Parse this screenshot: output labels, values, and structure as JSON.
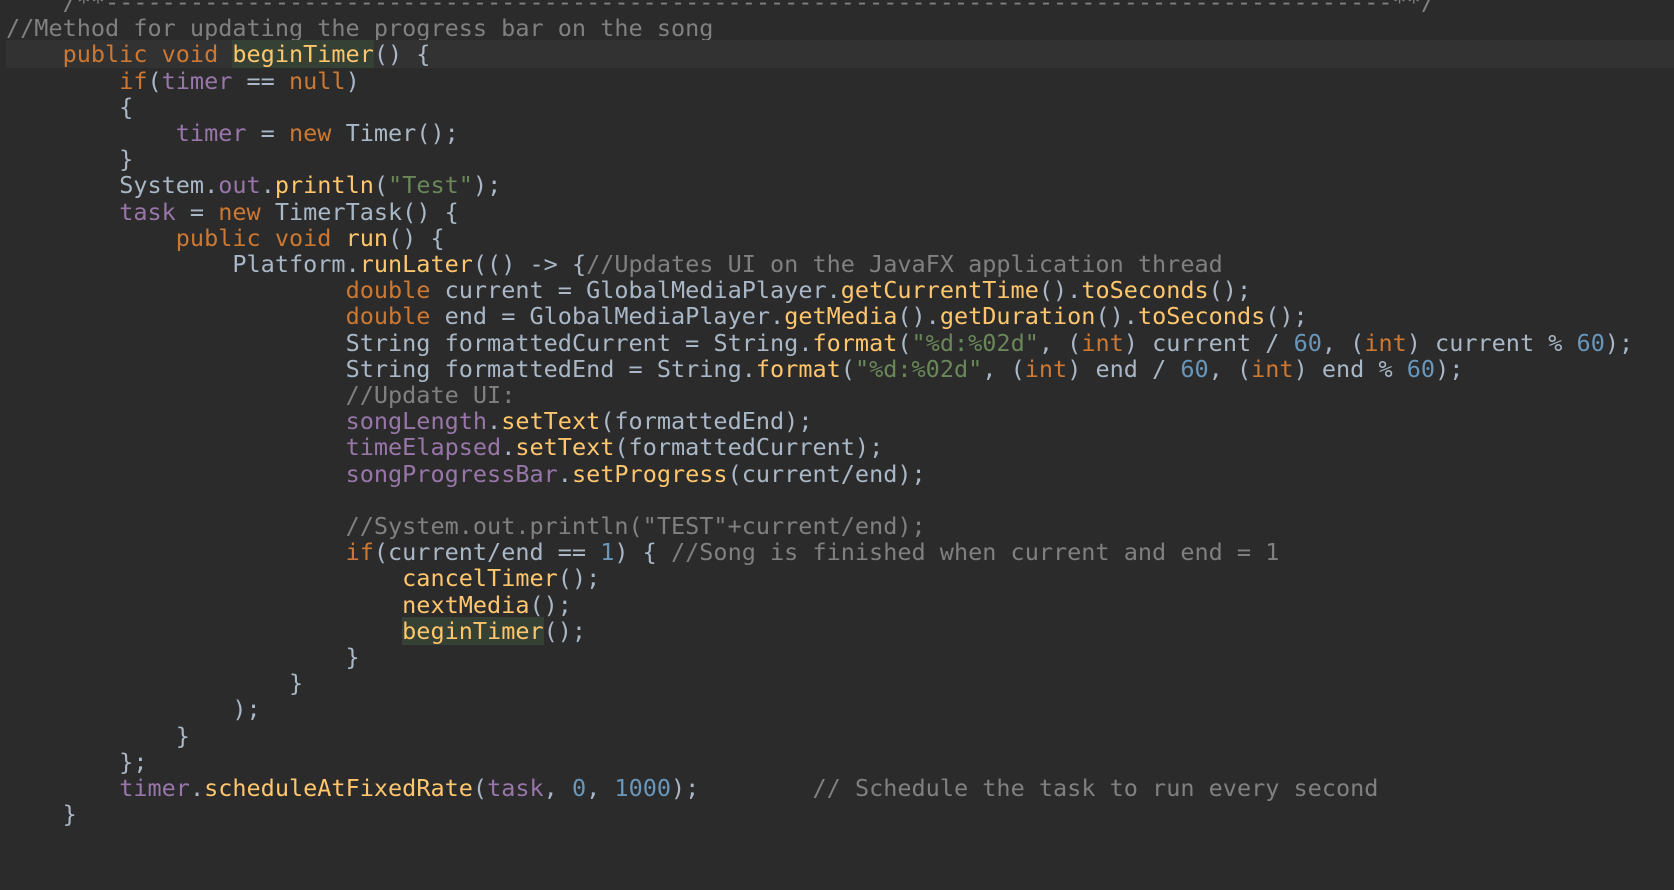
{
  "editor": {
    "lines": [
      [
        {
          "t": "    /**-------------------------------------------------------------------------------------------**/",
          "c": "comment"
        }
      ],
      [
        {
          "t": "//Method for updating the progress bar on the song",
          "c": "comment"
        }
      ],
      [
        {
          "t": "    ",
          "c": "default"
        },
        {
          "t": "public void ",
          "c": "keyword"
        },
        {
          "t": "beginTimer",
          "c": "method",
          "h": true
        },
        {
          "t": "() {",
          "c": "default"
        }
      ],
      [
        {
          "t": "        ",
          "c": "default"
        },
        {
          "t": "if",
          "c": "keyword"
        },
        {
          "t": "(",
          "c": "default"
        },
        {
          "t": "timer",
          "c": "field"
        },
        {
          "t": " == ",
          "c": "default"
        },
        {
          "t": "null",
          "c": "keyword"
        },
        {
          "t": ")",
          "c": "default"
        }
      ],
      [
        {
          "t": "        {",
          "c": "default"
        }
      ],
      [
        {
          "t": "            ",
          "c": "default"
        },
        {
          "t": "timer",
          "c": "field"
        },
        {
          "t": " = ",
          "c": "default"
        },
        {
          "t": "new ",
          "c": "keyword"
        },
        {
          "t": "Timer",
          "c": "class"
        },
        {
          "t": "();",
          "c": "default"
        }
      ],
      [
        {
          "t": "        }",
          "c": "default"
        }
      ],
      [
        {
          "t": "        ",
          "c": "default"
        },
        {
          "t": "System",
          "c": "class"
        },
        {
          "t": ".",
          "c": "default"
        },
        {
          "t": "out",
          "c": "field"
        },
        {
          "t": ".",
          "c": "default"
        },
        {
          "t": "println",
          "c": "method"
        },
        {
          "t": "(",
          "c": "default"
        },
        {
          "t": "\"Test\"",
          "c": "string"
        },
        {
          "t": ");",
          "c": "default"
        }
      ],
      [
        {
          "t": "        ",
          "c": "default"
        },
        {
          "t": "task",
          "c": "field"
        },
        {
          "t": " = ",
          "c": "default"
        },
        {
          "t": "new ",
          "c": "keyword"
        },
        {
          "t": "TimerTask",
          "c": "class"
        },
        {
          "t": "() {",
          "c": "default"
        }
      ],
      [
        {
          "t": "            ",
          "c": "default"
        },
        {
          "t": "public void ",
          "c": "keyword"
        },
        {
          "t": "run",
          "c": "method"
        },
        {
          "t": "() {",
          "c": "default"
        }
      ],
      [
        {
          "t": "                ",
          "c": "default"
        },
        {
          "t": "Platform",
          "c": "class"
        },
        {
          "t": ".",
          "c": "default"
        },
        {
          "t": "runLater",
          "c": "method"
        },
        {
          "t": "(() -> {",
          "c": "default"
        },
        {
          "t": "//Updates UI on the JavaFX application thread",
          "c": "comment"
        }
      ],
      [
        {
          "t": "                        ",
          "c": "default"
        },
        {
          "t": "double ",
          "c": "keyword"
        },
        {
          "t": "current = ",
          "c": "default"
        },
        {
          "t": "GlobalMediaPlayer",
          "c": "class"
        },
        {
          "t": ".",
          "c": "default"
        },
        {
          "t": "getCurrentTime",
          "c": "method"
        },
        {
          "t": "().",
          "c": "default"
        },
        {
          "t": "toSeconds",
          "c": "method"
        },
        {
          "t": "();",
          "c": "default"
        }
      ],
      [
        {
          "t": "                        ",
          "c": "default"
        },
        {
          "t": "double ",
          "c": "keyword"
        },
        {
          "t": "end = ",
          "c": "default"
        },
        {
          "t": "GlobalMediaPlayer",
          "c": "class"
        },
        {
          "t": ".",
          "c": "default"
        },
        {
          "t": "getMedia",
          "c": "method"
        },
        {
          "t": "().",
          "c": "default"
        },
        {
          "t": "getDuration",
          "c": "method"
        },
        {
          "t": "().",
          "c": "default"
        },
        {
          "t": "toSeconds",
          "c": "method"
        },
        {
          "t": "();",
          "c": "default"
        }
      ],
      [
        {
          "t": "                        ",
          "c": "default"
        },
        {
          "t": "String ",
          "c": "class"
        },
        {
          "t": "formattedCurrent = ",
          "c": "default"
        },
        {
          "t": "String",
          "c": "class"
        },
        {
          "t": ".",
          "c": "default"
        },
        {
          "t": "format",
          "c": "method"
        },
        {
          "t": "(",
          "c": "default"
        },
        {
          "t": "\"%d:%02d\"",
          "c": "string"
        },
        {
          "t": ", (",
          "c": "default"
        },
        {
          "t": "int",
          "c": "keyword"
        },
        {
          "t": ") current / ",
          "c": "default"
        },
        {
          "t": "60",
          "c": "number"
        },
        {
          "t": ", (",
          "c": "default"
        },
        {
          "t": "int",
          "c": "keyword"
        },
        {
          "t": ") current % ",
          "c": "default"
        },
        {
          "t": "60",
          "c": "number"
        },
        {
          "t": ");",
          "c": "default"
        }
      ],
      [
        {
          "t": "                        ",
          "c": "default"
        },
        {
          "t": "String ",
          "c": "class"
        },
        {
          "t": "formattedEnd = ",
          "c": "default"
        },
        {
          "t": "String",
          "c": "class"
        },
        {
          "t": ".",
          "c": "default"
        },
        {
          "t": "format",
          "c": "method"
        },
        {
          "t": "(",
          "c": "default"
        },
        {
          "t": "\"%d:%02d\"",
          "c": "string"
        },
        {
          "t": ", (",
          "c": "default"
        },
        {
          "t": "int",
          "c": "keyword"
        },
        {
          "t": ") end / ",
          "c": "default"
        },
        {
          "t": "60",
          "c": "number"
        },
        {
          "t": ", (",
          "c": "default"
        },
        {
          "t": "int",
          "c": "keyword"
        },
        {
          "t": ") end % ",
          "c": "default"
        },
        {
          "t": "60",
          "c": "number"
        },
        {
          "t": ");",
          "c": "default"
        }
      ],
      [
        {
          "t": "                        ",
          "c": "default"
        },
        {
          "t": "//Update UI:",
          "c": "comment"
        }
      ],
      [
        {
          "t": "                        ",
          "c": "default"
        },
        {
          "t": "songLength",
          "c": "field"
        },
        {
          "t": ".",
          "c": "default"
        },
        {
          "t": "setText",
          "c": "method"
        },
        {
          "t": "(formattedEnd);",
          "c": "default"
        }
      ],
      [
        {
          "t": "                        ",
          "c": "default"
        },
        {
          "t": "timeElapsed",
          "c": "field"
        },
        {
          "t": ".",
          "c": "default"
        },
        {
          "t": "setText",
          "c": "method"
        },
        {
          "t": "(formattedCurrent);",
          "c": "default"
        }
      ],
      [
        {
          "t": "                        ",
          "c": "default"
        },
        {
          "t": "songProgressBar",
          "c": "field"
        },
        {
          "t": ".",
          "c": "default"
        },
        {
          "t": "setProgress",
          "c": "method"
        },
        {
          "t": "(current/end);",
          "c": "default"
        }
      ],
      [
        {
          "t": "",
          "c": "default"
        }
      ],
      [
        {
          "t": "                        ",
          "c": "default"
        },
        {
          "t": "//System.out.println(\"TEST\"+current/end);",
          "c": "comment"
        }
      ],
      [
        {
          "t": "                        ",
          "c": "default"
        },
        {
          "t": "if",
          "c": "keyword"
        },
        {
          "t": "(current/end == ",
          "c": "default"
        },
        {
          "t": "1",
          "c": "number"
        },
        {
          "t": ") { ",
          "c": "default"
        },
        {
          "t": "//Song is finished when current and end = 1",
          "c": "comment"
        }
      ],
      [
        {
          "t": "                            ",
          "c": "default"
        },
        {
          "t": "cancelTimer",
          "c": "method"
        },
        {
          "t": "();",
          "c": "default"
        }
      ],
      [
        {
          "t": "                            ",
          "c": "default"
        },
        {
          "t": "nextMedia",
          "c": "method"
        },
        {
          "t": "();",
          "c": "default"
        }
      ],
      [
        {
          "t": "                            ",
          "c": "default"
        },
        {
          "t": "beginTimer",
          "c": "method",
          "h": true
        },
        {
          "t": "();",
          "c": "default"
        }
      ],
      [
        {
          "t": "                        }",
          "c": "default"
        }
      ],
      [
        {
          "t": "                    }",
          "c": "default"
        }
      ],
      [
        {
          "t": "                );",
          "c": "default"
        }
      ],
      [
        {
          "t": "            }",
          "c": "default"
        }
      ],
      [
        {
          "t": "        };",
          "c": "default"
        }
      ],
      [
        {
          "t": "        ",
          "c": "default"
        },
        {
          "t": "timer",
          "c": "field"
        },
        {
          "t": ".",
          "c": "default"
        },
        {
          "t": "scheduleAtFixedRate",
          "c": "method"
        },
        {
          "t": "(",
          "c": "default"
        },
        {
          "t": "task",
          "c": "field"
        },
        {
          "t": ", ",
          "c": "default"
        },
        {
          "t": "0",
          "c": "number"
        },
        {
          "t": ", ",
          "c": "default"
        },
        {
          "t": "1000",
          "c": "number"
        },
        {
          "t": ");        ",
          "c": "default"
        },
        {
          "t": "// Schedule the task to run every second",
          "c": "comment"
        }
      ],
      [
        {
          "t": "    }",
          "c": "default"
        }
      ]
    ]
  },
  "colors": {
    "background": "#2b2b2b",
    "current_line": "#323232",
    "keyword": "#cc7832",
    "comment": "#808080",
    "string": "#6a8759",
    "number": "#6897bb",
    "field": "#9876aa",
    "method": "#ffc66d",
    "text": "#a9b7c6",
    "highlight": "#344134"
  }
}
